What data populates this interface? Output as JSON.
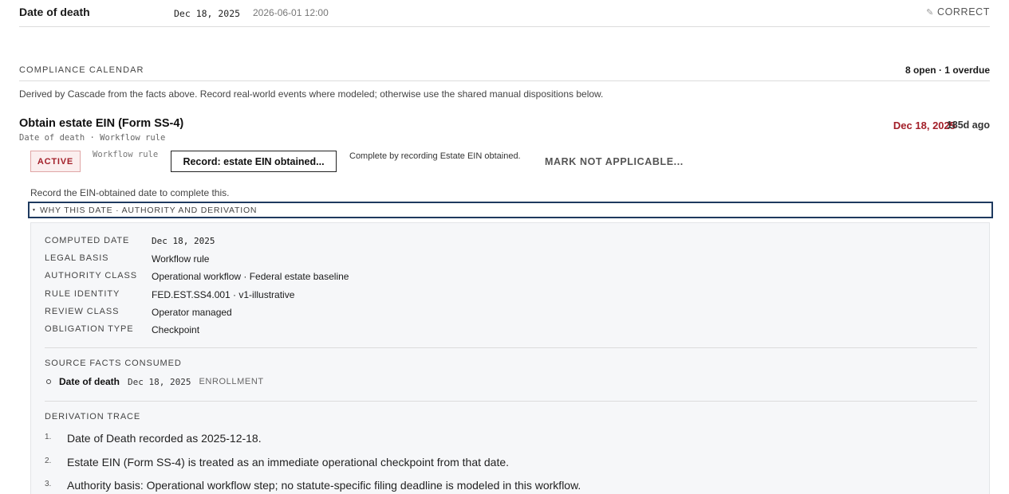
{
  "fact": {
    "label": "Date of death",
    "value": "Dec 18, 2025",
    "timestamp": "2026-06-01 12:00",
    "correct_icon": "pencil-icon",
    "correct_label": "CORRECT"
  },
  "calendar": {
    "title": "COMPLIANCE CALENDAR",
    "counts": "8 open · 1 overdue",
    "description": "Derived by Cascade from the facts above. Record real-world events where modeled; otherwise use the shared manual dispositions below."
  },
  "obligation": {
    "title": "Obtain estate EIN (Form SS-4)",
    "subtitle": "Date of death · Workflow rule",
    "due_date": "Dec 18, 2025",
    "age": "185d ago",
    "status": "ACTIVE",
    "rule_tag": "Workflow rule",
    "record_button": "Record: estate EIN obtained...",
    "complete_hint": "Complete by recording Estate EIN obtained.",
    "mark_na": "MARK NOT APPLICABLE...",
    "record_note": "Record the EIN-obtained date to complete this.",
    "why_toggle": "WHY THIS DATE · AUTHORITY AND DERIVATION"
  },
  "details": {
    "computed_date_label": "COMPUTED DATE",
    "computed_date": "Dec 18, 2025",
    "legal_basis_label": "LEGAL BASIS",
    "legal_basis": "Workflow rule",
    "authority_class_label": "AUTHORITY CLASS",
    "authority_class": "Operational workflow · Federal estate baseline",
    "rule_identity_label": "RULE IDENTITY",
    "rule_identity": "FED.EST.SS4.001 · v1-illustrative",
    "review_class_label": "REVIEW CLASS",
    "review_class": "Operator managed",
    "obligation_type_label": "OBLIGATION TYPE",
    "obligation_type": "Checkpoint",
    "source_facts_title": "SOURCE FACTS CONSUMED",
    "source_facts": [
      {
        "name": "Date of death",
        "date": "Dec 18, 2025",
        "kind": "ENROLLMENT"
      }
    ],
    "trace_title": "DERIVATION TRACE",
    "trace": [
      {
        "num": "1.",
        "text": "Date of Death recorded as 2025-12-18."
      },
      {
        "num": "2.",
        "text": "Estate EIN (Form SS-4) is treated as an immediate operational checkpoint from that date."
      },
      {
        "num": "3.",
        "text": "Authority basis: Operational workflow step; no statute-specific filing deadline is modeled in this workflow."
      }
    ]
  },
  "colors": {
    "overdue_red": "#a3202a",
    "focus_border": "#1e3a5f",
    "panel_bg": "#f6f7f9"
  }
}
